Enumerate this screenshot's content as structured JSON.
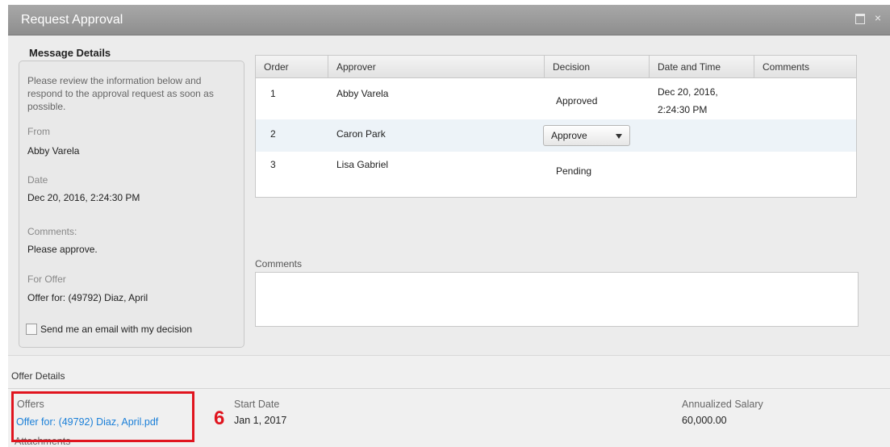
{
  "window": {
    "title": "Request Approval",
    "icons": [
      "maximize-icon",
      "close-icon"
    ],
    "close_glyph": "×"
  },
  "message_details": {
    "title": "Message Details",
    "intro": "Please review the information below and respond to the approval request as soon as possible.",
    "from_label": "From",
    "from_value": "Abby Varela",
    "date_label": "Date",
    "date_value": "Dec 20, 2016, 2:24:30 PM",
    "comments_label": "Comments:",
    "comments_value": "Please approve.",
    "offer_label": "For Offer",
    "offer_value": "Offer for: (49792) Diaz, April",
    "email_checkbox_label": "Send me an email with my decision",
    "email_checkbox_checked": false
  },
  "approvers": {
    "columns": [
      "Order",
      "Approver",
      "Decision",
      "Date and Time",
      "Comments"
    ],
    "rows": [
      {
        "order": "1",
        "approver": "Abby Varela",
        "decision": "Approved",
        "datetime_line1": "Dec 20, 2016,",
        "datetime_line2": "2:24:30 PM",
        "comments": ""
      },
      {
        "order": "2",
        "approver": "Caron Park",
        "decision_select": "Approve",
        "datetime_line1": "",
        "datetime_line2": "",
        "comments": ""
      },
      {
        "order": "3",
        "approver": "Lisa Gabriel",
        "decision": "Pending",
        "datetime_line1": "",
        "datetime_line2": "",
        "comments": ""
      }
    ]
  },
  "comments_field": {
    "label": "Comments",
    "value": ""
  },
  "offer_details": {
    "section_title": "Offer Details",
    "offers_label": "Offers",
    "offer_link": "Offer for: (49792) Diaz, April.pdf",
    "start_date_label": "Start Date",
    "start_date_value": "Jan 1, 2017",
    "salary_label": "Annualized Salary",
    "salary_value": "60,000.00",
    "attachments_label": "Attachments"
  },
  "annotation": {
    "step_number": "6",
    "color": "#e0141e"
  },
  "colors": {
    "title_bar": "#999999",
    "link": "#1a7fd8",
    "highlight": "#e0141e",
    "row_highlight": "#edf3f8"
  }
}
